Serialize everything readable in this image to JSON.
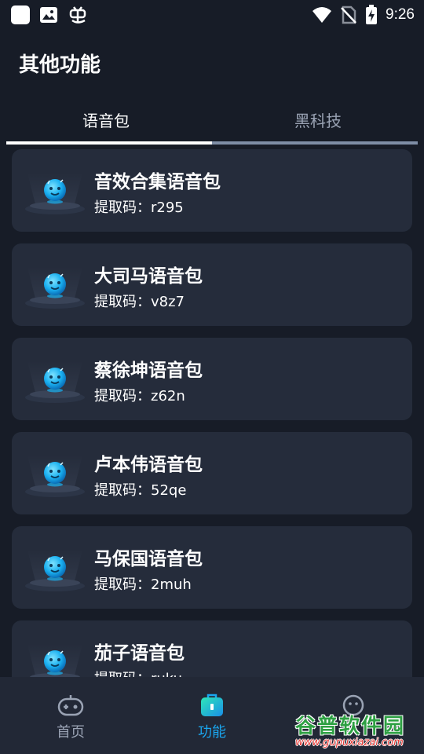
{
  "status_bar": {
    "time": "9:26",
    "left_icons": [
      "app-square-icon",
      "image-icon",
      "bug-icon"
    ],
    "right_icons": [
      "wifi-icon",
      "no-sim-icon",
      "battery-charging-icon"
    ]
  },
  "page": {
    "title": "其他功能"
  },
  "tabs": [
    {
      "label": "语音包",
      "active": true
    },
    {
      "label": "黑科技",
      "active": false
    }
  ],
  "voice_packs": [
    {
      "title": "音效合集语音包",
      "code": "提取码：r295"
    },
    {
      "title": "大司马语音包",
      "code": "提取码：v8z7"
    },
    {
      "title": "蔡徐坤语音包",
      "code": "提取码：z62n"
    },
    {
      "title": "卢本伟语音包",
      "code": "提取码：52qe"
    },
    {
      "title": "马保国语音包",
      "code": "提取码：2muh"
    },
    {
      "title": "茄子语音包",
      "code": "提取码：ruku"
    }
  ],
  "bottom_nav": [
    {
      "label": "首页",
      "icon": "gamepad-icon",
      "active": false
    },
    {
      "label": "功能",
      "icon": "toolbox-icon",
      "active": true
    },
    {
      "label": "",
      "icon": "smiley-icon",
      "active": false
    }
  ],
  "watermark": {
    "main": "谷普软件园",
    "url": "www.gupuxiazai.com"
  },
  "colors": {
    "background": "#171c27",
    "card": "#252c3b",
    "accent": "#1aa7f0",
    "muted": "#9aa3b4"
  }
}
